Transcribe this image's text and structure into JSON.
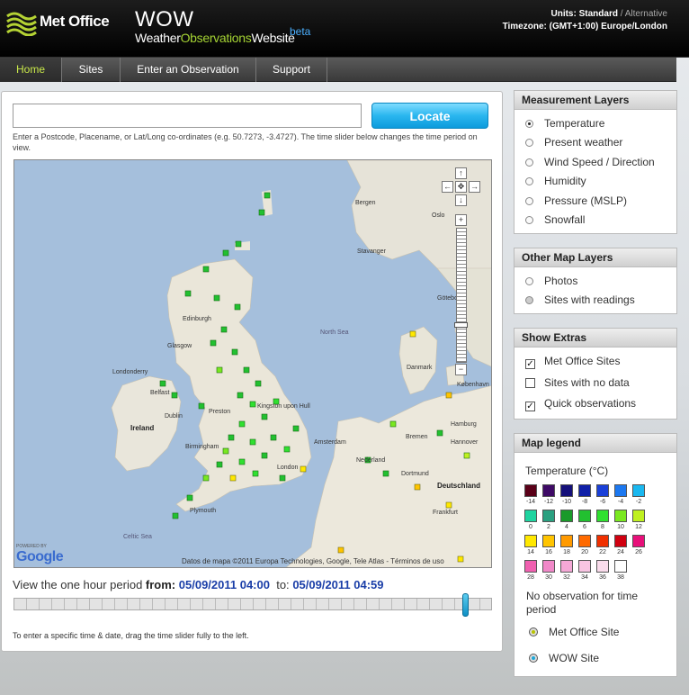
{
  "header": {
    "brand": "Met Office",
    "title": "WOW",
    "subtitle_parts": [
      "Weather",
      "Observations",
      "Website"
    ],
    "beta": "beta",
    "units_label": "Units:",
    "units_current": "Standard",
    "units_sep": " / ",
    "units_alt": "Alternative",
    "timezone": "Timezone: (GMT+1:00) Europe/London"
  },
  "nav": [
    {
      "label": "Home",
      "active": true
    },
    {
      "label": "Sites"
    },
    {
      "label": "Enter an Observation"
    },
    {
      "label": "Support"
    }
  ],
  "search": {
    "value": "",
    "button": "Locate",
    "hint": "Enter a Postcode, Placename, or Lat/Long co-ordinates (e.g. 50.7273, -3.4727). The time slider below changes the time period on view."
  },
  "map": {
    "labels": {
      "bergen": "Bergen",
      "oslo": "Oslo",
      "stavanger": "Stavanger",
      "goteborg": "Göteborg",
      "north_sea": "North Sea",
      "edinburgh": "Edinburgh",
      "londonderry": "Londonderry",
      "belfast": "Belfast",
      "ireland": "Ireland",
      "dublin": "Dublin",
      "preston": "Preston",
      "birmingham": "Birmingham",
      "london": "London",
      "plymouth": "Plymouth",
      "celtic_sea": "Celtic Sea",
      "amsterdam": "Amsterdam",
      "nederland": "Nederland",
      "deutschland": "Deutschland",
      "hamburg": "Hamburg",
      "hannover": "Hannover",
      "danmark": "Danmark",
      "bremen": "Bremen",
      "dortmund": "Dortmund",
      "kobenhavn": "København",
      "kingston": "Kingston upon Hull",
      "glasgow": "Glasgow",
      "frankfurt": "Frankfurt"
    },
    "powered_by": "POWERED BY",
    "google": "Google",
    "attribution": "Datos de mapa ©2011 Europa Technologies, Google, Tele Atlas - Términos de uso"
  },
  "time": {
    "prefix": "View the one hour period ",
    "from_label": "from:",
    "from_value": "05/09/2011 04:00",
    "to_label": "to:",
    "to_value": "05/09/2011 04:59",
    "slider_position": 0.95,
    "hint": "To enter a specific time & date, drag the time slider fully to the left."
  },
  "measurement_layers": {
    "title": "Measurement Layers",
    "options": [
      "Temperature",
      "Present weather",
      "Wind Speed / Direction",
      "Humidity",
      "Pressure (MSLP)",
      "Snowfall"
    ],
    "selected": 0
  },
  "other_layers": {
    "title": "Other Map Layers",
    "options": [
      "Photos",
      "Sites with readings"
    ]
  },
  "show_extras": {
    "title": "Show Extras",
    "options": [
      {
        "label": "Met Office Sites",
        "checked": true
      },
      {
        "label": "Sites with no data",
        "checked": false
      },
      {
        "label": "Quick observations",
        "checked": true
      }
    ]
  },
  "legend": {
    "title": "Map legend",
    "subtitle": "Temperature (°C)",
    "swatches": [
      {
        "label": "-14",
        "color": "#5a0018"
      },
      {
        "label": "-12",
        "color": "#3e0a66"
      },
      {
        "label": "-10",
        "color": "#15107a"
      },
      {
        "label": "-8",
        "color": "#1020a8"
      },
      {
        "label": "-6",
        "color": "#1a40d8"
      },
      {
        "label": "-4",
        "color": "#1c78f0"
      },
      {
        "label": "-2",
        "color": "#1ab8f0"
      },
      {
        "label": "0",
        "color": "#1ed4a0"
      },
      {
        "label": "2",
        "color": "#2aa080"
      },
      {
        "label": "4",
        "color": "#1a9a2a"
      },
      {
        "label": "6",
        "color": "#22c030"
      },
      {
        "label": "8",
        "color": "#30e030"
      },
      {
        "label": "10",
        "color": "#7ae820"
      },
      {
        "label": "12",
        "color": "#bff020"
      },
      {
        "label": "14",
        "color": "#ffe800"
      },
      {
        "label": "16",
        "color": "#ffc400"
      },
      {
        "label": "18",
        "color": "#ff9a00"
      },
      {
        "label": "20",
        "color": "#ff6a00"
      },
      {
        "label": "22",
        "color": "#f03000"
      },
      {
        "label": "24",
        "color": "#d00010"
      },
      {
        "label": "26",
        "color": "#e8107a"
      },
      {
        "label": "28",
        "color": "#f060b0"
      },
      {
        "label": "30",
        "color": "#f088c8"
      },
      {
        "label": "32",
        "color": "#f4a8d6"
      },
      {
        "label": "34",
        "color": "#f8c4e2"
      },
      {
        "label": "36",
        "color": "#fadcec"
      },
      {
        "label": "38",
        "color": "#ffffff"
      }
    ],
    "no_obs": "No observation for time period",
    "met_office_site": "Met Office Site",
    "wow_site": "WOW Site"
  }
}
